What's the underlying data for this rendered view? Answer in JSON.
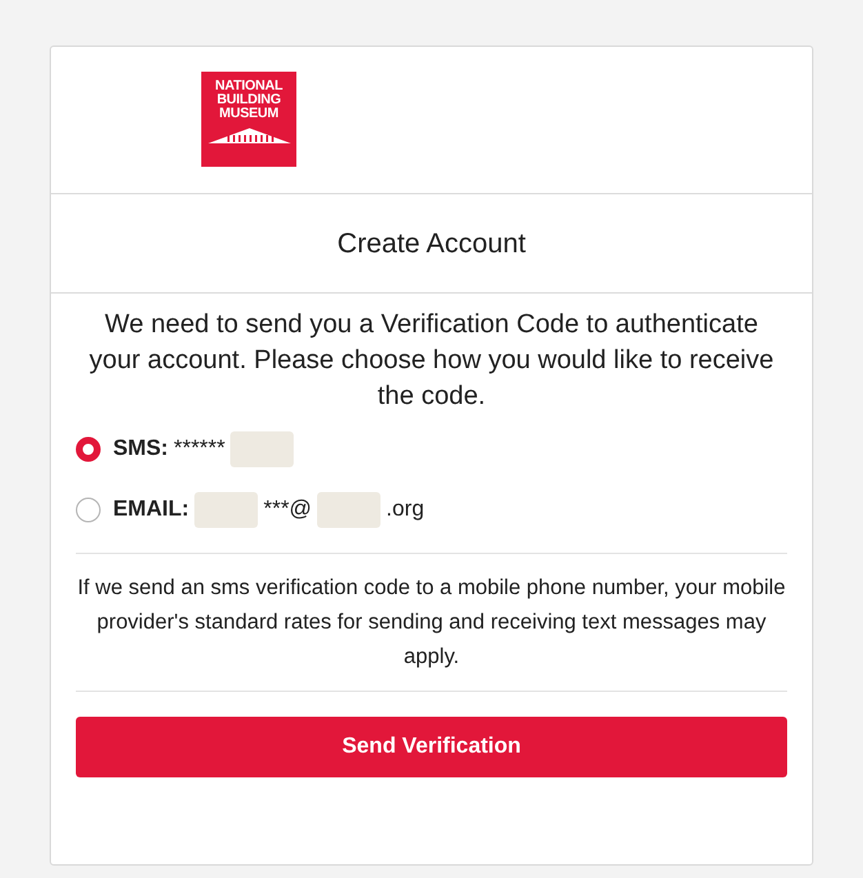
{
  "logo": {
    "lines": [
      "NATIONAL",
      "BUILDING",
      "MUSEUM"
    ]
  },
  "title": "Create Account",
  "intro": "We need to send you a Verification Code to authenticate your account. Please choose how you would like to receive the code.",
  "options": [
    {
      "label": "SMS:",
      "selected": true,
      "parts": [
        {
          "kind": "text",
          "text": "******"
        },
        {
          "kind": "redacted"
        }
      ]
    },
    {
      "label": "EMAIL:",
      "selected": false,
      "parts": [
        {
          "kind": "redacted"
        },
        {
          "kind": "text",
          "text": "***@"
        },
        {
          "kind": "redacted"
        },
        {
          "kind": "text",
          "text": ".org"
        }
      ]
    }
  ],
  "notice": "If we send an sms verification code to a mobile phone number, your mobile provider's standard rates for sending and receiving text messages may apply.",
  "button": "Send Verification"
}
